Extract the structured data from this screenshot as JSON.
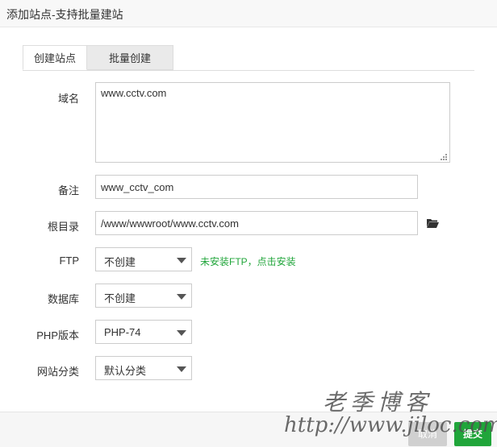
{
  "window": {
    "title": "添加站点-支持批量建站"
  },
  "tabs": [
    {
      "label": "创建站点",
      "active": true
    },
    {
      "label": "批量创建",
      "active": false
    }
  ],
  "form": {
    "domain": {
      "label": "域名",
      "value": "www.cctv.com"
    },
    "remark": {
      "label": "备注",
      "value": "www_cctv_com"
    },
    "root": {
      "label": "根目录",
      "value": "/www/wwwroot/www.cctv.com"
    },
    "ftp": {
      "label": "FTP",
      "value": "不创建",
      "hint": "未安装FTP，点击安装"
    },
    "database": {
      "label": "数据库",
      "value": "不创建"
    },
    "php": {
      "label": "PHP版本",
      "value": "PHP-74"
    },
    "category": {
      "label": "网站分类",
      "value": "默认分类"
    }
  },
  "buttons": {
    "cancel": "取消",
    "submit": "提交"
  },
  "watermark": {
    "line1": "老季博客",
    "line2": "http://www.jiloc.com"
  },
  "colors": {
    "accent": "#20a53a",
    "hint": "#20a53a",
    "cancel": "#d0d0d0"
  },
  "icons": {
    "root_picker": "folder-open-icon",
    "resize": "resize-grip-icon",
    "select_caret": "caret-down-icon"
  }
}
